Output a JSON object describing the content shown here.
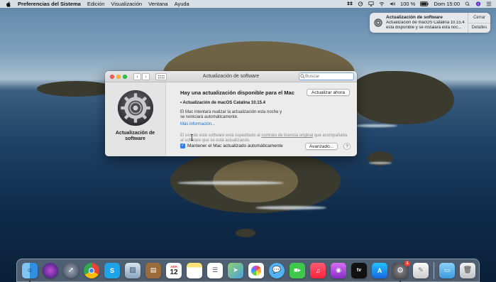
{
  "menubar": {
    "app_name": "Preferencias del Sistema",
    "menus": [
      "Edición",
      "Visualización",
      "Ventana",
      "Ayuda"
    ],
    "battery": "100 %",
    "clock": "Dom 15:00"
  },
  "notification": {
    "title": "Actualización de software",
    "body_line1": "Actualización de macOS Catalina 10.15.4",
    "body_line2": "está disponible y se instalará esta noc...",
    "close_label": "Cerrar",
    "details_label": "Detalles"
  },
  "window": {
    "title": "Actualización de software",
    "search_placeholder": "Buscar",
    "pane_name": "Actualización de software",
    "headline": "Hay una actualización disponible para el Mac",
    "update_button": "Actualizar ahora",
    "update_item": "• Actualización de macOS Catalina 10.15.4",
    "notice": "El Mac intentará realizar la actualización esta noche y se reiniciará automáticamente.",
    "more_info": "Más información...",
    "license_pre": "El uso de este software está supeditado al ",
    "license_link": "contrato de licencia original",
    "license_post": " que acompañaba al software que se está actualizando.",
    "keep_updated": "Mantener el Mac actualizado automáticamente",
    "keep_updated_checked": true,
    "advanced_button": "Avanzado...",
    "help_button": "?"
  },
  "dock": {
    "calendar_month": "ABR",
    "calendar_day": "12",
    "system_prefs_badge": "1",
    "tv_label": "tv"
  },
  "colors": {
    "accent": "#2a7cf4",
    "link": "#1a6fd4"
  }
}
